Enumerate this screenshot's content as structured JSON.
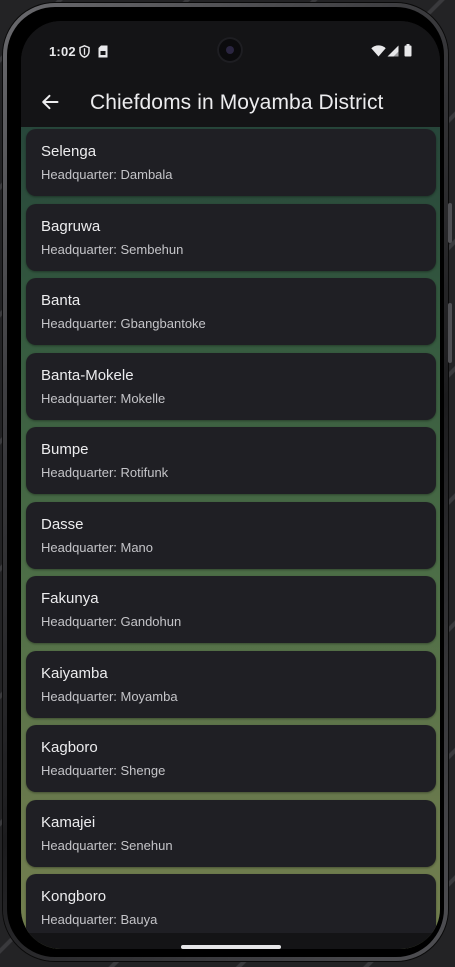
{
  "status_bar": {
    "time": "1:02",
    "icons": [
      "shield-icon",
      "sim-card-icon",
      "wifi-icon",
      "signal-icon",
      "battery-icon"
    ]
  },
  "app_bar": {
    "back_icon": "arrow-back-icon",
    "title": "Chiefdoms in Moyamba District"
  },
  "chiefdoms": [
    {
      "name": "Selenga",
      "hq": "Headquarter: Dambala"
    },
    {
      "name": "Bagruwa",
      "hq": "Headquarter: Sembehun"
    },
    {
      "name": "Banta",
      "hq": "Headquarter: Gbangbantoke"
    },
    {
      "name": "Banta-Mokele",
      "hq": "Headquarter: Mokelle"
    },
    {
      "name": "Bumpe",
      "hq": "Headquarter: Rotifunk"
    },
    {
      "name": "Dasse",
      "hq": "Headquarter: Mano"
    },
    {
      "name": "Fakunya",
      "hq": "Headquarter: Gandohun"
    },
    {
      "name": "Kaiyamba",
      "hq": "Headquarter: Moyamba"
    },
    {
      "name": "Kagboro",
      "hq": "Headquarter: Shenge"
    },
    {
      "name": "Kamajei",
      "hq": "Headquarter: Senehun"
    },
    {
      "name": "Kongboro",
      "hq": "Headquarter: Bauya"
    }
  ],
  "colors": {
    "card_background": "#1f1f24",
    "app_bar_background": "#141416",
    "list_gradient_top": "#27463a",
    "list_gradient_bottom": "#74804f"
  }
}
